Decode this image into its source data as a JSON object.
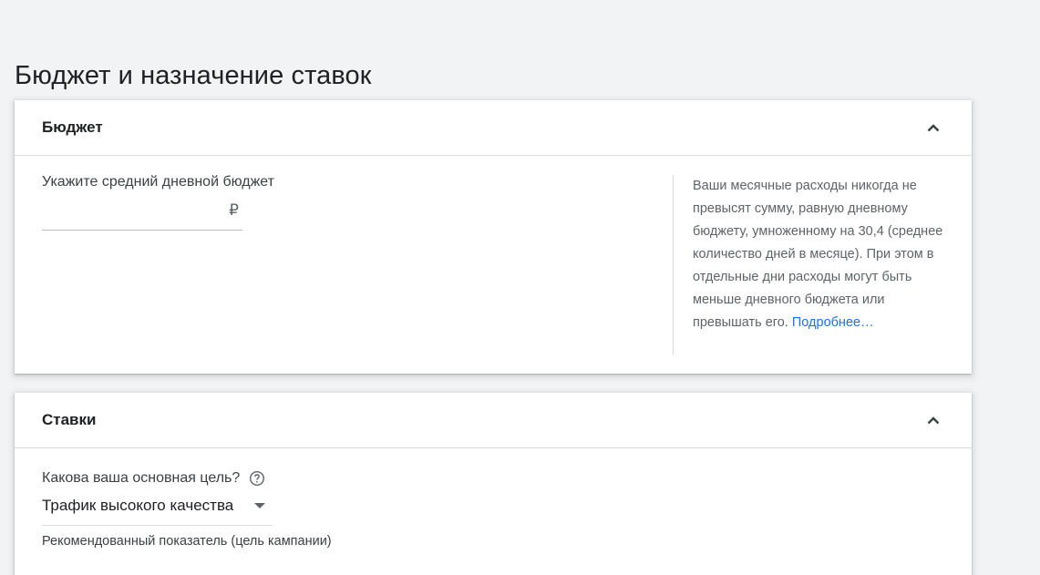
{
  "page": {
    "title": "Бюджет и назначение ставок"
  },
  "budget_card": {
    "title": "Бюджет",
    "collapse_icon": "chevron-up-icon",
    "field_label": "Укажите средний дневной бюджет",
    "input_value": "",
    "currency": "₽",
    "help_text": "Ваши месячные расходы никогда не превысят сумму, равную дневному бюджету, умноженному на 30,4 (среднее количество дней в месяце). При этом в отдельные дни расходы могут быть меньше дневного бюджета или превышать его.",
    "help_link": "Подробнее…"
  },
  "bids_card": {
    "title": "Ставки",
    "collapse_icon": "chevron-up-icon",
    "goal_label": "Какова ваша основная цель?",
    "help_icon": "question-circle-icon",
    "goal_value": "Трафик высокого качества",
    "recommended_label": "Рекомендованный показатель (цель кампании)"
  },
  "colors": {
    "background": "#f1f3f4",
    "card": "#ffffff",
    "link": "#1a73e8",
    "divider": "#dadce0"
  }
}
